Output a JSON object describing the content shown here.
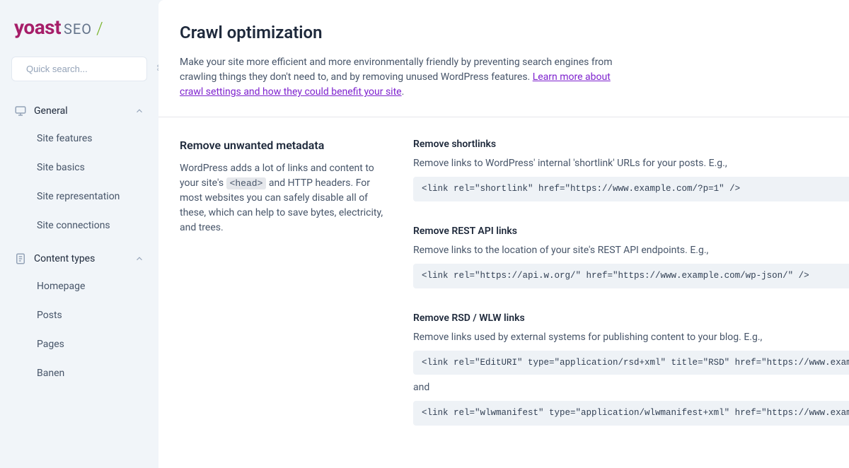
{
  "logo": {
    "brand": "yoast",
    "suffix": "SEO",
    "slash": "/"
  },
  "search": {
    "placeholder": "Quick search...",
    "shortcut": "⌘K"
  },
  "nav": {
    "general": {
      "label": "General",
      "items": [
        "Site features",
        "Site basics",
        "Site representation",
        "Site connections"
      ]
    },
    "content_types": {
      "label": "Content types",
      "items": [
        "Homepage",
        "Posts",
        "Pages",
        "Banen"
      ]
    }
  },
  "page": {
    "title": "Crawl optimization",
    "description_pre": "Make your site more efficient and more environmentally friendly by preventing search engines from crawling things they don't need to, and by removing unused WordPress features. ",
    "description_link": "Learn more about crawl settings and how they could benefit your site",
    "description_post": "."
  },
  "section": {
    "title": "Remove unwanted metadata",
    "desc_pre": "WordPress adds a lot of links and content to your site's ",
    "desc_code": "<head>",
    "desc_post": " and HTTP headers. For most websites you can safely disable all of these, which can help to save bytes, electricity, and trees."
  },
  "settings": {
    "shortlinks": {
      "title": "Remove shortlinks",
      "desc": "Remove links to WordPress' internal 'shortlink' URLs for your posts. E.g.,",
      "code": "<link rel=\"shortlink\" href=\"https://www.example.com/?p=1\" />"
    },
    "rest": {
      "title": "Remove REST API links",
      "desc": "Remove links to the location of your site's REST API endpoints. E.g.,",
      "code": "<link rel=\"https://api.w.org/\" href=\"https://www.example.com/wp-json/\" />"
    },
    "rsd": {
      "title": "Remove RSD / WLW links",
      "desc": "Remove links used by external systems for publishing content to your blog. E.g.,",
      "code1": "<link rel=\"EditURI\" type=\"application/rsd+xml\" title=\"RSD\" href=\"https://www.examp",
      "and": "and",
      "code2": "<link rel=\"wlwmanifest\" type=\"application/wlwmanifest+xml\" href=\"https://www.examp"
    }
  }
}
